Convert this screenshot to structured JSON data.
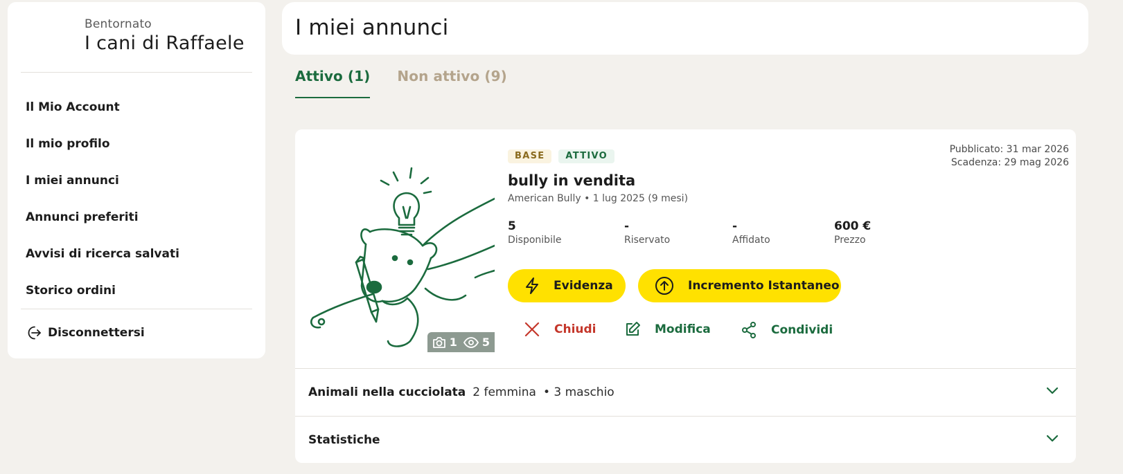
{
  "sidebar": {
    "welcome": "Bentornato",
    "user_name": "I cani di Raffaele",
    "nav": [
      {
        "label": "Il Mio Account"
      },
      {
        "label": "Il mio profilo"
      },
      {
        "label": "I miei annunci"
      },
      {
        "label": "Annunci preferiti"
      },
      {
        "label": "Avvisi di ricerca salvati"
      },
      {
        "label": "Storico ordini"
      }
    ],
    "logout_label": "Disconnettersi"
  },
  "header": {
    "title": "I miei annunci"
  },
  "tabs": [
    {
      "label": "Attivo (1)",
      "active": true
    },
    {
      "label": "Non attivo (9)",
      "active": false
    }
  ],
  "listing": {
    "badges": {
      "plan": "BASE",
      "status": "ATTIVO"
    },
    "published": "Pubblicato: 31 mar 2026",
    "expires": "Scadenza: 29 mag 2026",
    "title": "bully in vendita",
    "subtitle": "American Bully • 1 lug 2025 (9 mesi)",
    "photo": {
      "photos_count": "1",
      "views_count": "5",
      "illustration": "dog-with-pencil-and-lightbulb"
    },
    "stats": [
      {
        "value": "5",
        "label": "Disponibile"
      },
      {
        "value": "-",
        "label": "Riservato"
      },
      {
        "value": "-",
        "label": "Affidato"
      },
      {
        "value": "600 €",
        "label": "Prezzo"
      }
    ],
    "buttons": {
      "highlight": "Evidenza",
      "boost": "Incremento Istantaneo"
    },
    "actions": {
      "close": "Chiudi",
      "edit": "Modifica",
      "share": "Condividi"
    },
    "litter": {
      "title": "Animali nella cucciolata",
      "females": "2 femmina",
      "males": "• 3 maschio"
    },
    "statistics": {
      "title": "Statistiche"
    }
  },
  "colors": {
    "accent_green": "#1b6b3e",
    "button_yellow": "#ffe100",
    "danger_red": "#c4362a",
    "inactive_tab": "#b4a48c",
    "background": "#f3f1ed"
  }
}
